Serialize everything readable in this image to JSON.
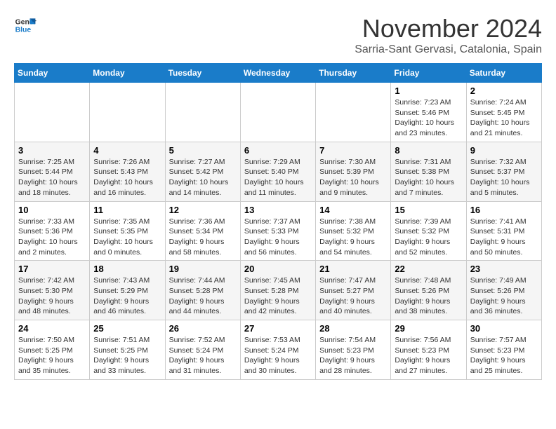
{
  "header": {
    "logo_line1": "General",
    "logo_line2": "Blue",
    "month": "November 2024",
    "location": "Sarria-Sant Gervasi, Catalonia, Spain"
  },
  "days_of_week": [
    "Sunday",
    "Monday",
    "Tuesday",
    "Wednesday",
    "Thursday",
    "Friday",
    "Saturday"
  ],
  "weeks": [
    [
      {
        "day": "",
        "detail": ""
      },
      {
        "day": "",
        "detail": ""
      },
      {
        "day": "",
        "detail": ""
      },
      {
        "day": "",
        "detail": ""
      },
      {
        "day": "",
        "detail": ""
      },
      {
        "day": "1",
        "detail": "Sunrise: 7:23 AM\nSunset: 5:46 PM\nDaylight: 10 hours\nand 23 minutes."
      },
      {
        "day": "2",
        "detail": "Sunrise: 7:24 AM\nSunset: 5:45 PM\nDaylight: 10 hours\nand 21 minutes."
      }
    ],
    [
      {
        "day": "3",
        "detail": "Sunrise: 7:25 AM\nSunset: 5:44 PM\nDaylight: 10 hours\nand 18 minutes."
      },
      {
        "day": "4",
        "detail": "Sunrise: 7:26 AM\nSunset: 5:43 PM\nDaylight: 10 hours\nand 16 minutes."
      },
      {
        "day": "5",
        "detail": "Sunrise: 7:27 AM\nSunset: 5:42 PM\nDaylight: 10 hours\nand 14 minutes."
      },
      {
        "day": "6",
        "detail": "Sunrise: 7:29 AM\nSunset: 5:40 PM\nDaylight: 10 hours\nand 11 minutes."
      },
      {
        "day": "7",
        "detail": "Sunrise: 7:30 AM\nSunset: 5:39 PM\nDaylight: 10 hours\nand 9 minutes."
      },
      {
        "day": "8",
        "detail": "Sunrise: 7:31 AM\nSunset: 5:38 PM\nDaylight: 10 hours\nand 7 minutes."
      },
      {
        "day": "9",
        "detail": "Sunrise: 7:32 AM\nSunset: 5:37 PM\nDaylight: 10 hours\nand 5 minutes."
      }
    ],
    [
      {
        "day": "10",
        "detail": "Sunrise: 7:33 AM\nSunset: 5:36 PM\nDaylight: 10 hours\nand 2 minutes."
      },
      {
        "day": "11",
        "detail": "Sunrise: 7:35 AM\nSunset: 5:35 PM\nDaylight: 10 hours\nand 0 minutes."
      },
      {
        "day": "12",
        "detail": "Sunrise: 7:36 AM\nSunset: 5:34 PM\nDaylight: 9 hours\nand 58 minutes."
      },
      {
        "day": "13",
        "detail": "Sunrise: 7:37 AM\nSunset: 5:33 PM\nDaylight: 9 hours\nand 56 minutes."
      },
      {
        "day": "14",
        "detail": "Sunrise: 7:38 AM\nSunset: 5:32 PM\nDaylight: 9 hours\nand 54 minutes."
      },
      {
        "day": "15",
        "detail": "Sunrise: 7:39 AM\nSunset: 5:32 PM\nDaylight: 9 hours\nand 52 minutes."
      },
      {
        "day": "16",
        "detail": "Sunrise: 7:41 AM\nSunset: 5:31 PM\nDaylight: 9 hours\nand 50 minutes."
      }
    ],
    [
      {
        "day": "17",
        "detail": "Sunrise: 7:42 AM\nSunset: 5:30 PM\nDaylight: 9 hours\nand 48 minutes."
      },
      {
        "day": "18",
        "detail": "Sunrise: 7:43 AM\nSunset: 5:29 PM\nDaylight: 9 hours\nand 46 minutes."
      },
      {
        "day": "19",
        "detail": "Sunrise: 7:44 AM\nSunset: 5:28 PM\nDaylight: 9 hours\nand 44 minutes."
      },
      {
        "day": "20",
        "detail": "Sunrise: 7:45 AM\nSunset: 5:28 PM\nDaylight: 9 hours\nand 42 minutes."
      },
      {
        "day": "21",
        "detail": "Sunrise: 7:47 AM\nSunset: 5:27 PM\nDaylight: 9 hours\nand 40 minutes."
      },
      {
        "day": "22",
        "detail": "Sunrise: 7:48 AM\nSunset: 5:26 PM\nDaylight: 9 hours\nand 38 minutes."
      },
      {
        "day": "23",
        "detail": "Sunrise: 7:49 AM\nSunset: 5:26 PM\nDaylight: 9 hours\nand 36 minutes."
      }
    ],
    [
      {
        "day": "24",
        "detail": "Sunrise: 7:50 AM\nSunset: 5:25 PM\nDaylight: 9 hours\nand 35 minutes."
      },
      {
        "day": "25",
        "detail": "Sunrise: 7:51 AM\nSunset: 5:25 PM\nDaylight: 9 hours\nand 33 minutes."
      },
      {
        "day": "26",
        "detail": "Sunrise: 7:52 AM\nSunset: 5:24 PM\nDaylight: 9 hours\nand 31 minutes."
      },
      {
        "day": "27",
        "detail": "Sunrise: 7:53 AM\nSunset: 5:24 PM\nDaylight: 9 hours\nand 30 minutes."
      },
      {
        "day": "28",
        "detail": "Sunrise: 7:54 AM\nSunset: 5:23 PM\nDaylight: 9 hours\nand 28 minutes."
      },
      {
        "day": "29",
        "detail": "Sunrise: 7:56 AM\nSunset: 5:23 PM\nDaylight: 9 hours\nand 27 minutes."
      },
      {
        "day": "30",
        "detail": "Sunrise: 7:57 AM\nSunset: 5:23 PM\nDaylight: 9 hours\nand 25 minutes."
      }
    ]
  ]
}
